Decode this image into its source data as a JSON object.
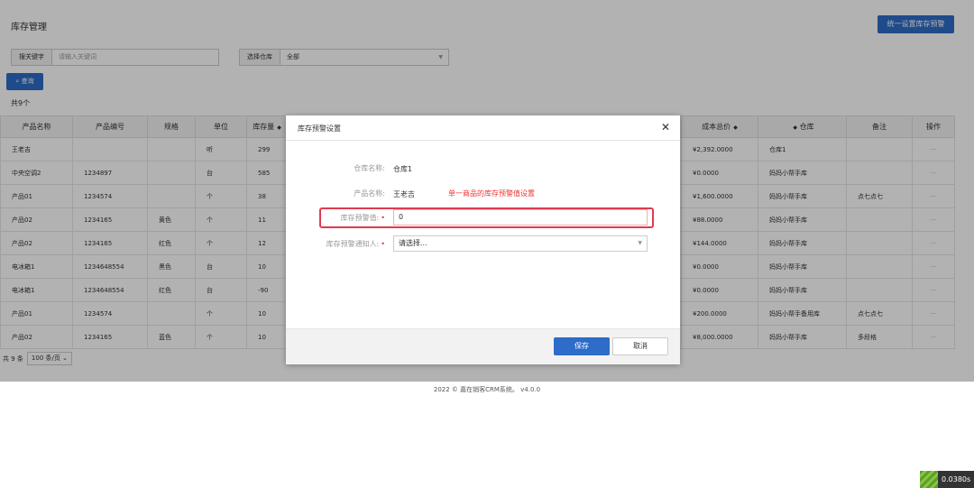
{
  "page": {
    "title": "库存管理",
    "unified_button": "统一设置库存预警",
    "filters": {
      "keyword_label": "搜关键字",
      "keyword_placeholder": "请输入关键词",
      "warehouse_label": "选择仓库",
      "warehouse_value": "全部"
    },
    "search_button": "查询",
    "count_text": "共9个"
  },
  "table": {
    "columns": [
      "产品名称",
      "产品编号",
      "规格",
      "单位",
      "库存量",
      "",
      "",
      "",
      "",
      "成本总价",
      "仓库",
      "备注",
      "操作"
    ],
    "rows": [
      [
        "王老吉",
        "",
        "",
        "听",
        "299",
        "¥2,392.0000",
        "仓库1",
        "",
        "···"
      ],
      [
        "中央空调2",
        "1234897",
        "",
        "台",
        "585",
        "¥0.0000",
        "妈妈小帮手库",
        "",
        "···"
      ],
      [
        "产品01",
        "1234574",
        "",
        "个",
        "38",
        "¥1,600.0000",
        "妈妈小帮手库",
        "点七点七",
        "···"
      ],
      [
        "产品02",
        "1234165",
        "黄色",
        "个",
        "11",
        "¥88.0000",
        "妈妈小帮手库",
        "",
        "···"
      ],
      [
        "产品02",
        "1234165",
        "红色",
        "个",
        "12",
        "¥144.0000",
        "妈妈小帮手库",
        "",
        "···"
      ],
      [
        "电冰箱1",
        "1234648554",
        "黑色",
        "台",
        "10",
        "¥0.0000",
        "妈妈小帮手库",
        "",
        "···"
      ],
      [
        "电冰箱1",
        "1234648554",
        "红色",
        "台",
        "-90",
        "¥0.0000",
        "妈妈小帮手库",
        "",
        "···"
      ],
      [
        "产品01",
        "1234574",
        "",
        "个",
        "10",
        "¥200.0000",
        "妈妈小帮手备用库",
        "点七点七",
        "···"
      ],
      [
        "产品02",
        "1234165",
        "蓝色",
        "个",
        "10",
        "¥8,000.0000",
        "妈妈小帮手库",
        "多段格",
        "···"
      ]
    ]
  },
  "pager": {
    "total": "共 9 条",
    "page_size": "100 条/页"
  },
  "footer": "2022 © 嘉在销客CRM系统。 v4.0.0",
  "modal": {
    "title": "库存预警设置",
    "warehouse_label": "仓库名称:",
    "warehouse_value": "仓库1",
    "product_label": "产品名称:",
    "product_value": "王老吉",
    "note": "单一商品的库存预警值设置",
    "threshold_label": "库存预警值:",
    "threshold_value": "0",
    "notify_label": "库存预警通知人:",
    "notify_placeholder": "请选择...",
    "save": "保存",
    "cancel": "取消"
  },
  "perf": "0.0380s",
  "colors": {
    "primary": "#2d6cc8",
    "danger": "#e33333",
    "highlight": "#e03b4e"
  }
}
